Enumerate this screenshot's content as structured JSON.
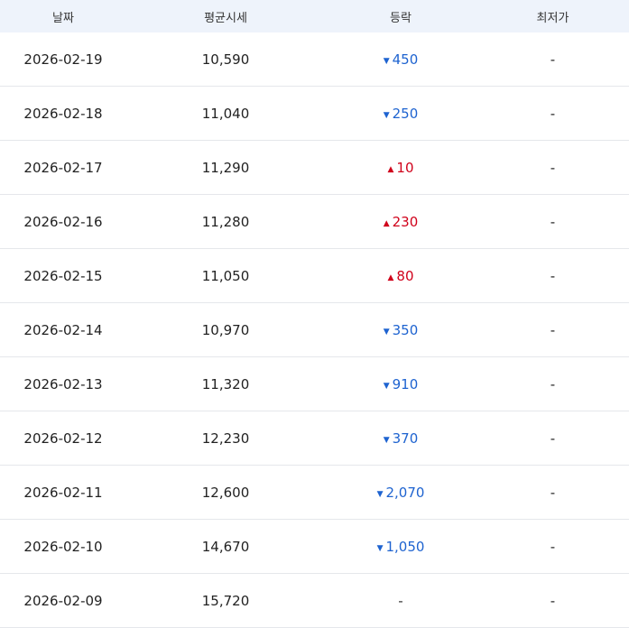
{
  "header": {
    "date": "날짜",
    "avg_price": "평균시세",
    "change": "등락",
    "lowest": "최저가"
  },
  "icons": {
    "up": "▲",
    "down": "▼"
  },
  "colors": {
    "header_bg": "#eef3fb",
    "down": "#1e63d0",
    "up": "#d0021b"
  },
  "rows": [
    {
      "date": "2026-02-19",
      "price": "10,590",
      "dir": "down",
      "change": "450",
      "lowest": "-"
    },
    {
      "date": "2026-02-18",
      "price": "11,040",
      "dir": "down",
      "change": "250",
      "lowest": "-"
    },
    {
      "date": "2026-02-17",
      "price": "11,290",
      "dir": "up",
      "change": "10",
      "lowest": "-"
    },
    {
      "date": "2026-02-16",
      "price": "11,280",
      "dir": "up",
      "change": "230",
      "lowest": "-"
    },
    {
      "date": "2026-02-15",
      "price": "11,050",
      "dir": "up",
      "change": "80",
      "lowest": "-"
    },
    {
      "date": "2026-02-14",
      "price": "10,970",
      "dir": "down",
      "change": "350",
      "lowest": "-"
    },
    {
      "date": "2026-02-13",
      "price": "11,320",
      "dir": "down",
      "change": "910",
      "lowest": "-"
    },
    {
      "date": "2026-02-12",
      "price": "12,230",
      "dir": "down",
      "change": "370",
      "lowest": "-"
    },
    {
      "date": "2026-02-11",
      "price": "12,600",
      "dir": "down",
      "change": "2,070",
      "lowest": "-"
    },
    {
      "date": "2026-02-10",
      "price": "14,670",
      "dir": "down",
      "change": "1,050",
      "lowest": "-"
    },
    {
      "date": "2026-02-09",
      "price": "15,720",
      "dir": "none",
      "change": "-",
      "lowest": "-"
    }
  ]
}
